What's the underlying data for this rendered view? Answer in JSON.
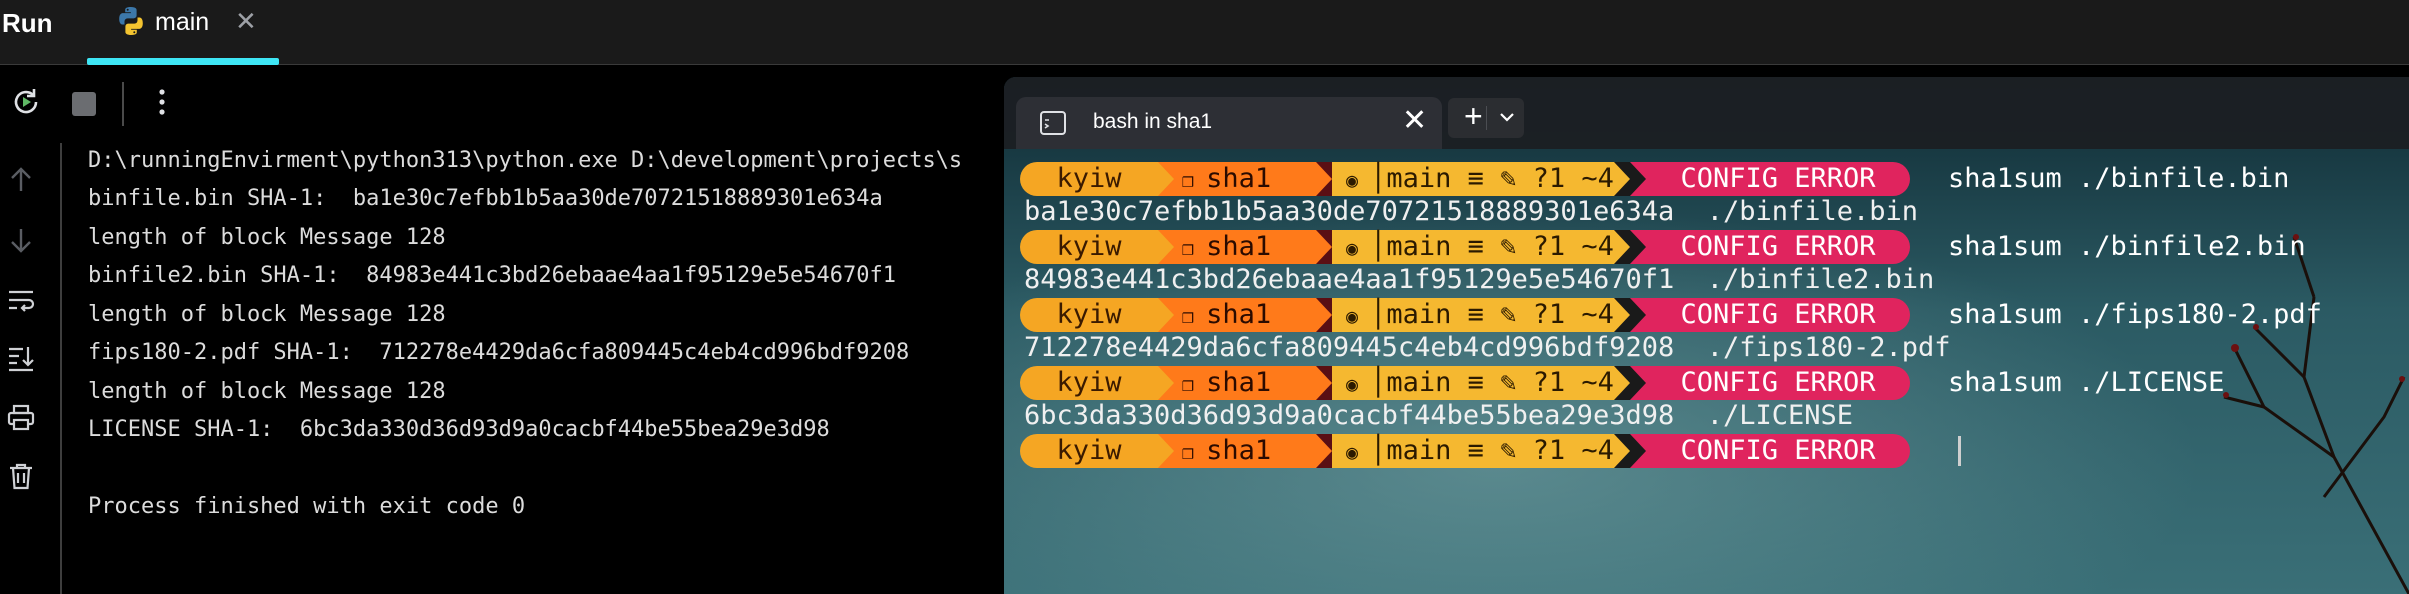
{
  "panel": {
    "title": "Run"
  },
  "tab": {
    "label": "main",
    "close_glyph": "✕",
    "icon": "python-icon"
  },
  "toolbar": {
    "rerun_icon": "rerun-icon",
    "stop_icon": "stop-icon",
    "more_icon": "more-vertical-icon"
  },
  "gutter": {
    "icons": [
      "arrow-up-icon",
      "arrow-down-icon",
      "soft-wrap-icon",
      "scroll-to-end-icon",
      "print-icon",
      "trash-icon"
    ]
  },
  "console": {
    "lines": [
      "D:\\runningEnvirment\\python313\\python.exe D:\\development\\projects\\s",
      "binfile.bin SHA-1:  ba1e30c7efbb1b5aa30de70721518889301e634a",
      "length of block Message 128",
      "binfile2.bin SHA-1:  84983e441c3bd26ebaae4aa1f95129e5e54670f1",
      "length of block Message 128",
      "fips180-2.pdf SHA-1:  712278e4429da6cfa809445c4eb4cd996bdf9208",
      "length of block Message 128",
      "LICENSE SHA-1:  6bc3da330d36d93d9a0cacbf44be55bea29e3d98",
      "",
      "Process finished with exit code 0"
    ]
  },
  "terminal": {
    "tab_title": "bash in sha1",
    "tab_close": "✕",
    "new_tab": "+",
    "prompt": {
      "user": "kyiw",
      "dir": "sha1",
      "branch": "main",
      "status": "≡ ✎ ?1 ~4",
      "error": "CONFIG ERROR"
    },
    "commands": [
      {
        "cmd": "sha1sum ./binfile.bin",
        "out": "ba1e30c7efbb1b5aa30de70721518889301e634a  ./binfile.bin"
      },
      {
        "cmd": "sha1sum ./binfile2.bin",
        "out": "84983e441c3bd26ebaae4aa1f95129e5e54670f1  ./binfile2.bin"
      },
      {
        "cmd": "sha1sum ./fips180-2.pdf",
        "out": "712278e4429da6cfa809445c4eb4cd996bdf9208  ./fips180-2.pdf"
      },
      {
        "cmd": "sha1sum ./LICENSE",
        "out": "6bc3da330d36d93d9a0cacbf44be55bea29e3d98  ./LICENSE"
      }
    ]
  },
  "colors": {
    "tab_underline": "#3ee6f5",
    "segment_user": "#f5a623",
    "segment_dir": "#ff7a1a",
    "segment_git": "#f5b830",
    "segment_error": "#e0245e"
  }
}
